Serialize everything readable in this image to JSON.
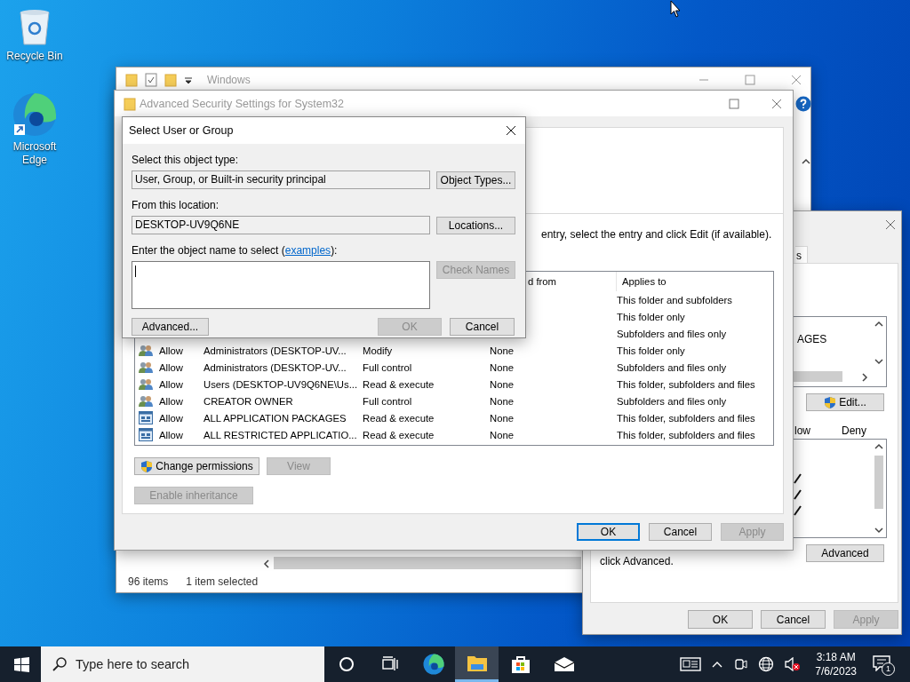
{
  "desktop_icons": [
    {
      "label": "Recycle Bin",
      "kind": "recycle"
    },
    {
      "label": "Microsoft Edge",
      "kind": "edge"
    }
  ],
  "explorer": {
    "title": "Windows",
    "status_bar": [
      "96 items",
      "1 item selected"
    ]
  },
  "properties": {
    "tab_fragment": "s",
    "list_fragment": "AGES",
    "edit_button": "Edit...",
    "columns": [
      "low",
      "Deny"
    ],
    "permission_checks": [
      {
        "checked": true
      },
      {
        "checked": true
      },
      {
        "checked": true
      }
    ],
    "note": "click Advanced.",
    "advanced_button": "Advanced",
    "buttons": [
      {
        "label": "OK",
        "disabled": false
      },
      {
        "label": "Cancel",
        "disabled": false
      },
      {
        "label": "Apply",
        "disabled": true
      }
    ]
  },
  "advanced_security": {
    "title": "Advanced Security Settings for System32",
    "instruction": "entry, select the entry and click Edit (if available).",
    "columns": [
      "d from",
      "Applies to"
    ],
    "rows": [
      {
        "applies_to": "This folder and subfolders"
      },
      {
        "applies_to": "This folder only"
      },
      {
        "applies_to": "Subfolders and files only"
      },
      {
        "kind": "users",
        "type": "Allow",
        "principal": "Administrators (DESKTOP-UV...",
        "access": "Modify",
        "inherited": "None",
        "applies_to": "This folder only"
      },
      {
        "kind": "users",
        "type": "Allow",
        "principal": "Administrators (DESKTOP-UV...",
        "access": "Full control",
        "inherited": "None",
        "applies_to": "Subfolders and files only"
      },
      {
        "kind": "users",
        "type": "Allow",
        "principal": "Users (DESKTOP-UV9Q6NE\\Us...",
        "access": "Read & execute",
        "inherited": "None",
        "applies_to": "This folder, subfolders and files"
      },
      {
        "kind": "users",
        "type": "Allow",
        "principal": "CREATOR OWNER",
        "access": "Full control",
        "inherited": "None",
        "applies_to": "Subfolders and files only"
      },
      {
        "kind": "package",
        "type": "Allow",
        "principal": "ALL APPLICATION PACKAGES",
        "access": "Read & execute",
        "inherited": "None",
        "applies_to": "This folder, subfolders and files"
      },
      {
        "kind": "package",
        "type": "Allow",
        "principal": "ALL RESTRICTED APPLICATIO...",
        "access": "Read & execute",
        "inherited": "None",
        "applies_to": "This folder, subfolders and files"
      }
    ],
    "actions": [
      {
        "label": "Change permissions",
        "disabled": false,
        "shield": true
      },
      {
        "label": "View",
        "disabled": true,
        "shield": false
      },
      {
        "label": "Enable inheritance",
        "disabled": true,
        "shield": false
      }
    ],
    "buttons": [
      {
        "label": "OK",
        "disabled": false,
        "default": true
      },
      {
        "label": "Cancel",
        "disabled": false,
        "default": false
      },
      {
        "label": "Apply",
        "disabled": true,
        "default": false
      }
    ]
  },
  "dialog": {
    "title": "Select User or Group",
    "object_type_label": "Select this object type:",
    "object_type": "User, Group, or Built-in security principal",
    "object_types_button": "Object Types...",
    "location_label": "From this location:",
    "location": "DESKTOP-UV9Q6NE",
    "locations_button": "Locations...",
    "name_label_before": "Enter the object name to select (",
    "name_label_link": "examples",
    "name_label_after": "):",
    "check_names": {
      "label": "Check Names",
      "disabled": true
    },
    "buttons": [
      {
        "label": "Advanced...",
        "disabled": false
      },
      {
        "label": "OK",
        "disabled": true
      },
      {
        "label": "Cancel",
        "disabled": false
      }
    ]
  },
  "taskbar": {
    "search": {
      "placeholder": "Type here to search"
    },
    "apps": [
      {
        "kind": "cortana",
        "selected": false
      },
      {
        "kind": "taskview",
        "selected": false
      },
      {
        "kind": "edge",
        "selected": false
      },
      {
        "kind": "explorer",
        "selected": true
      },
      {
        "kind": "store",
        "selected": false
      },
      {
        "kind": "mail",
        "selected": false
      }
    ],
    "time": "3:18 AM",
    "date": "7/6/2023",
    "notification_count": "1"
  }
}
